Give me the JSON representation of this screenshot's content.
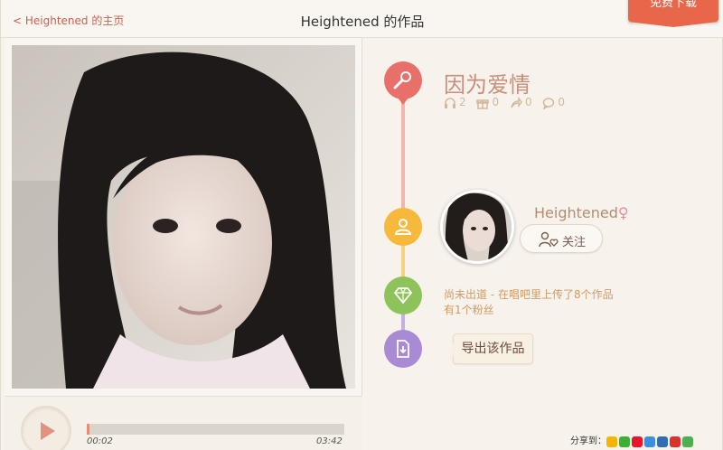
{
  "header": {
    "back_label": "< Heightened 的主页",
    "title": "Heightened 的作品",
    "download_label": "免费下载"
  },
  "player": {
    "current_time": "00:02",
    "total_time": "03:42",
    "progress_fraction": 0.01
  },
  "song": {
    "title": "因为爱情",
    "stats": {
      "listens": "2",
      "gifts": "0",
      "shares": "0",
      "comments": "0"
    }
  },
  "user": {
    "name": "Heightened",
    "gender_symbol": "♀",
    "follow_label": "关注"
  },
  "info": {
    "line1": "尚未出道 - 在唱吧里上传了8个作品",
    "line2": "有1个粉丝"
  },
  "export": {
    "label": "导出该作品"
  },
  "share": {
    "label": "分享到："
  },
  "colors": {
    "node_song": "#e86f6a",
    "node_user": "#f6b93b",
    "node_info": "#8dc35a",
    "node_export": "#a98ad4",
    "accent": "#c6614f"
  }
}
